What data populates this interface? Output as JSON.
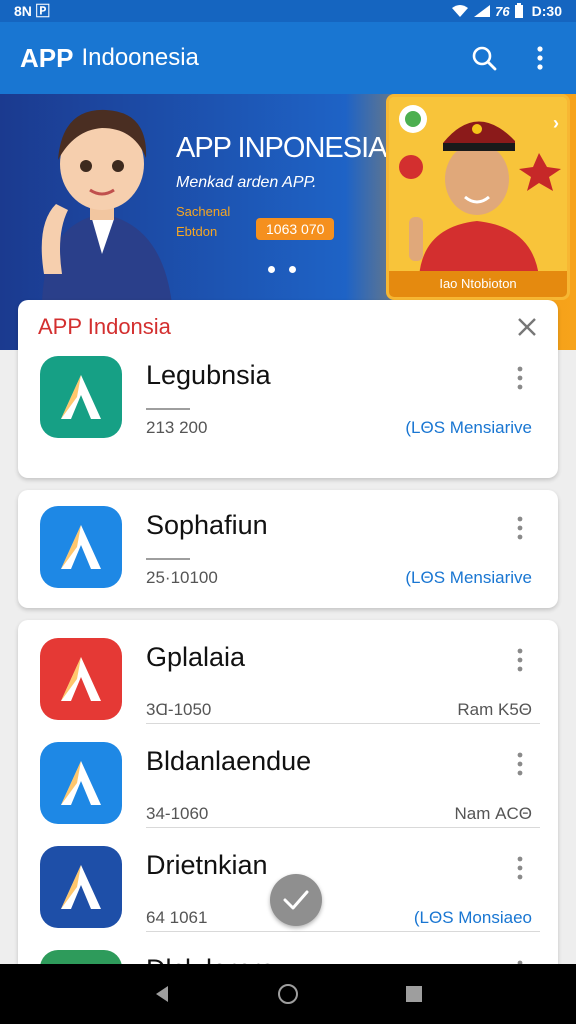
{
  "status": {
    "left": "8N 🄿",
    "time": "D:30",
    "battery": "76"
  },
  "app_bar": {
    "logo": "APP",
    "title": "Indoonesia"
  },
  "banner": {
    "title": "APP INPONESIA",
    "subtitle": "Menkad arden APP.",
    "line1": "Sachenal",
    "line2": "Ebtdon",
    "pill": "1063 070",
    "promo_caption": "Iao Ntobioton"
  },
  "section": {
    "title": "APP Indonsia"
  },
  "apps": [
    {
      "name": "Legubnsia",
      "meta": "213 200",
      "right": "(LΘS Mensiarive",
      "right_color": "#1976d2",
      "icon_color": "#16a085"
    },
    {
      "name": "Sophafiun",
      "meta": "25·10100",
      "right": "(LΘS Mensiarive",
      "right_color": "#1976d2",
      "icon_color": "#1e88e5"
    },
    {
      "name": "Gplalaia",
      "meta": "3Ɑ-1050",
      "right": "Ram K5Θ",
      "right_color": "#555555",
      "icon_color": "#e53935"
    },
    {
      "name": "Bldanlaendue",
      "meta": "34-1060",
      "right": "Nam ΑCΘ",
      "right_color": "#555555",
      "icon_color": "#1e88e5"
    },
    {
      "name": "Drietnkian",
      "meta": "64 1061",
      "right": "(LΘS Monsiaeo",
      "right_color": "#1976d2",
      "icon_color": "#1e4fa8"
    },
    {
      "name": "Dlclulorpra",
      "meta": "",
      "right": "",
      "right_color": "#555555",
      "icon_color": "#2e9b5b"
    }
  ]
}
